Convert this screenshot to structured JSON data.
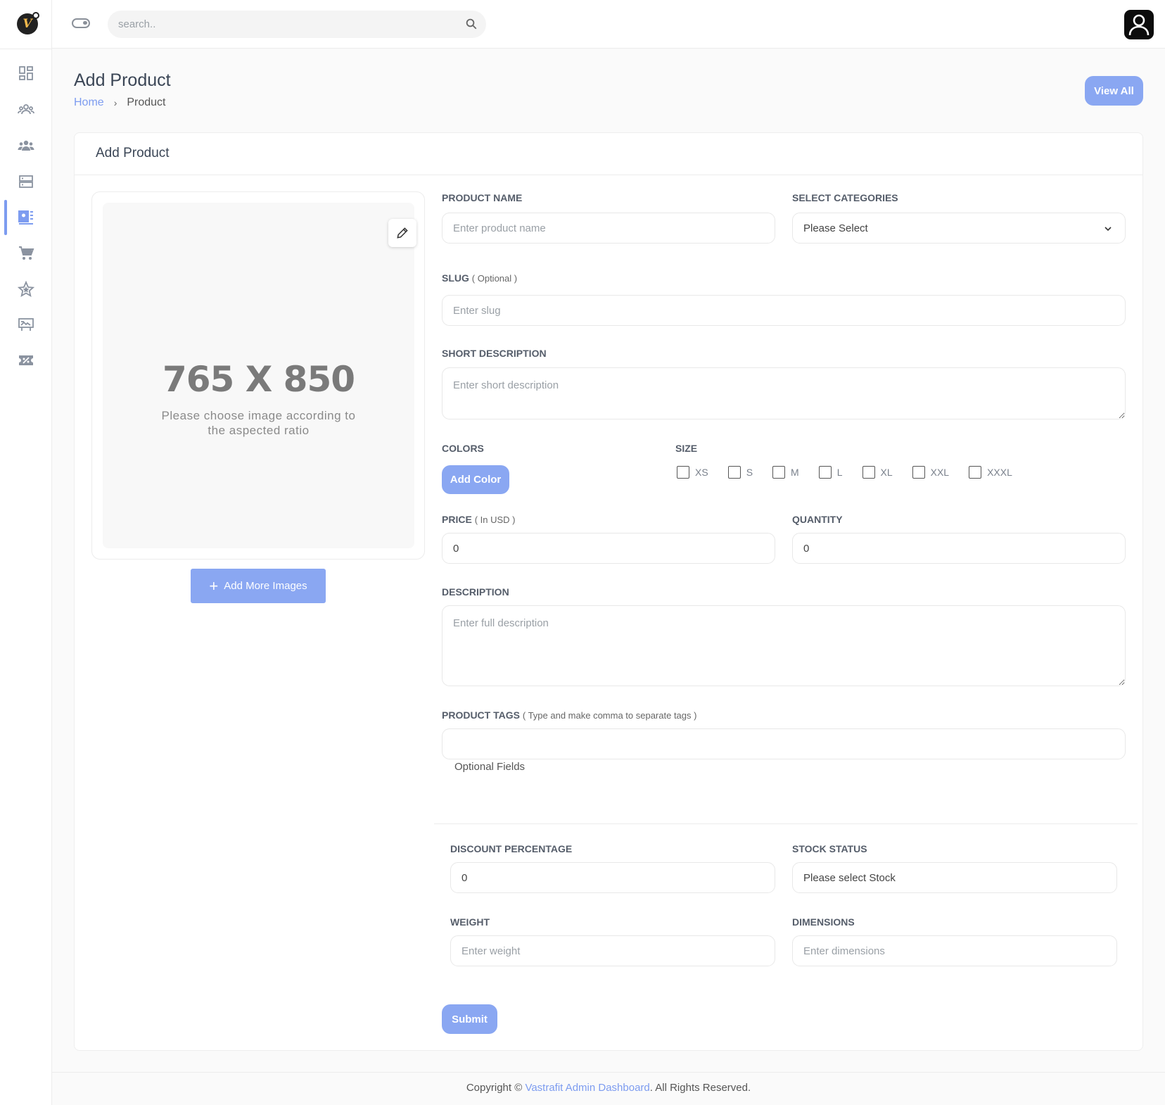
{
  "brand": {
    "logo_letter": "V"
  },
  "topbar": {
    "search_placeholder": "search.."
  },
  "sidebar": {
    "items": [
      {
        "name": "dashboard"
      },
      {
        "name": "users"
      },
      {
        "name": "customers"
      },
      {
        "name": "categories"
      },
      {
        "name": "products",
        "active": true
      },
      {
        "name": "orders"
      },
      {
        "name": "reviews"
      },
      {
        "name": "banners"
      },
      {
        "name": "coupons"
      }
    ]
  },
  "page": {
    "title": "Add Product",
    "breadcrumb": {
      "home": "Home",
      "separator": "›",
      "current": "Product"
    },
    "view_all_label": "View All"
  },
  "card": {
    "title": "Add Product",
    "image": {
      "dimensions": "765 X 850",
      "hint": "Please choose image according to the aspected ratio",
      "add_more_label": "Add More Images",
      "add_more_icon": "+"
    },
    "form": {
      "product_name": {
        "label": "PRODUCT NAME",
        "placeholder": "Enter product name",
        "value": ""
      },
      "categories": {
        "label": "SELECT CATEGORIES",
        "value": "Please Select"
      },
      "slug": {
        "label": "SLUG",
        "note": "( Optional )",
        "placeholder": "Enter slug",
        "value": ""
      },
      "short_description": {
        "label": "SHORT DESCRIPTION",
        "placeholder": "Enter short description"
      },
      "colors": {
        "label": "COLORS",
        "button": "Add Color"
      },
      "size": {
        "label": "SIZE",
        "options": [
          "XS",
          "S",
          "M",
          "L",
          "XL",
          "XXL",
          "XXXL"
        ]
      },
      "price": {
        "label": "PRICE",
        "note": "( In USD )",
        "value": "0"
      },
      "quantity": {
        "label": "QUANTITY",
        "value": "0"
      },
      "description": {
        "label": "DESCRIPTION",
        "placeholder": "Enter full description"
      },
      "tags": {
        "label": "PRODUCT TAGS",
        "note": "( Type and make comma to separate tags )",
        "value": ""
      },
      "optional_heading": "Optional Fields",
      "discount": {
        "label": "DISCOUNT PERCENTAGE",
        "value": "0"
      },
      "stock_status": {
        "label": "STOCK STATUS",
        "value": "Please select Stock"
      },
      "weight": {
        "label": "WEIGHT",
        "placeholder": "Enter weight"
      },
      "dimensions": {
        "label": "DIMENSIONS",
        "placeholder": "Enter dimensions"
      },
      "submit_label": "Submit"
    }
  },
  "footer": {
    "prefix": "Copyright © ",
    "link": "Vastrafit Admin Dashboard",
    "suffix": ". All Rights Reserved."
  },
  "colors": {
    "accent": "#8aa7f2",
    "link": "#7d9cf0",
    "text": "#3b4656",
    "background": "#fafafa"
  }
}
